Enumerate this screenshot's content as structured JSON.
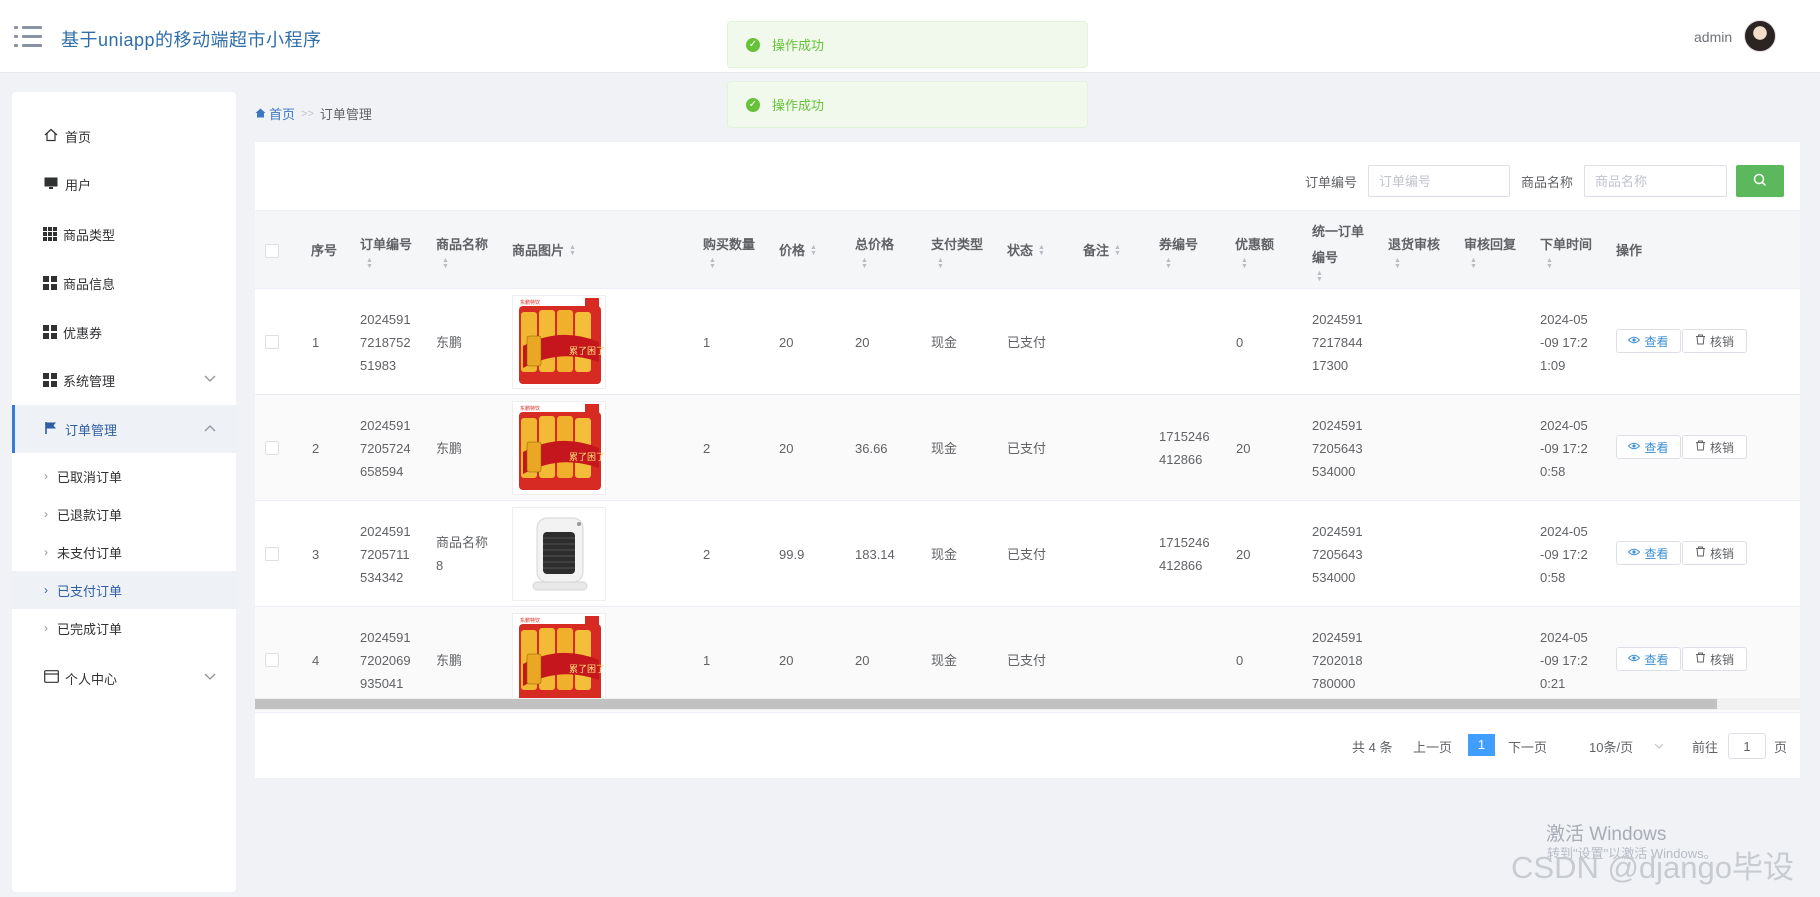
{
  "header": {
    "app_title": "基于uniapp的移动端超市小程序",
    "user_name": "admin"
  },
  "toasts": [
    {
      "message": "操作成功"
    },
    {
      "message": "操作成功"
    }
  ],
  "sidebar": {
    "items": [
      {
        "label": "首页",
        "icon": "home-icon"
      },
      {
        "label": "用户",
        "icon": "monitor-icon"
      },
      {
        "label": "商品类型",
        "icon": "grid-icon"
      },
      {
        "label": "商品信息",
        "icon": "grid-icon"
      },
      {
        "label": "优惠券",
        "icon": "grid-icon"
      },
      {
        "label": "系统管理",
        "icon": "grid-icon"
      },
      {
        "label": "订单管理",
        "icon": "flag-icon"
      },
      {
        "label": "个人中心",
        "icon": "card-icon"
      }
    ],
    "sub_items": [
      {
        "label": "已取消订单"
      },
      {
        "label": "已退款订单"
      },
      {
        "label": "未支付订单"
      },
      {
        "label": "已支付订单"
      },
      {
        "label": "已完成订单"
      }
    ]
  },
  "breadcrumb": {
    "home": "首页",
    "separator": ">>",
    "current": "订单管理"
  },
  "search": {
    "order_no_label": "订单编号",
    "order_no_placeholder": "订单编号",
    "product_name_label": "商品名称",
    "product_name_placeholder": "商品名称"
  },
  "table": {
    "columns": {
      "index": "序号",
      "order_no": "订单编号",
      "product_name": "商品名称",
      "product_image": "商品图片",
      "quantity": "购买数量",
      "price": "价格",
      "total": "总价格",
      "pay_type": "支付类型",
      "status": "状态",
      "remark": "备注",
      "coupon_no": "券编号",
      "discount": "优惠额",
      "unified_no": "统一订单\n编号",
      "refund_review": "退货审核",
      "review_reply": "审核回复",
      "order_time": "下单时间",
      "actions": "操作"
    },
    "rows": [
      {
        "index": "1",
        "order_no": "2024591\n7218752\n51983",
        "product_name": "东鹏",
        "image": "drink",
        "quantity": "1",
        "price": "20",
        "total": "20",
        "pay_type": "现金",
        "status": "已支付",
        "remark": "",
        "coupon_no": "",
        "discount": "0",
        "unified_no": "2024591\n7217844\n17300",
        "refund_review": "",
        "review_reply": "",
        "order_time": "2024-05\n-09 17:2\n1:09"
      },
      {
        "index": "2",
        "order_no": "2024591\n7205724\n658594",
        "product_name": "东鹏",
        "image": "drink",
        "quantity": "2",
        "price": "20",
        "total": "36.66",
        "pay_type": "现金",
        "status": "已支付",
        "remark": "",
        "coupon_no": "1715246\n412866",
        "discount": "20",
        "unified_no": "2024591\n7205643\n534000",
        "refund_review": "",
        "review_reply": "",
        "order_time": "2024-05\n-09 17:2\n0:58"
      },
      {
        "index": "3",
        "order_no": "2024591\n7205711\n534342",
        "product_name": "商品名称\n8",
        "image": "heater",
        "quantity": "2",
        "price": "99.9",
        "total": "183.14",
        "pay_type": "现金",
        "status": "已支付",
        "remark": "",
        "coupon_no": "1715246\n412866",
        "discount": "20",
        "unified_no": "2024591\n7205643\n534000",
        "refund_review": "",
        "review_reply": "",
        "order_time": "2024-05\n-09 17:2\n0:58"
      },
      {
        "index": "4",
        "order_no": "2024591\n7202069\n935041",
        "product_name": "东鹏",
        "image": "drink",
        "quantity": "1",
        "price": "20",
        "total": "20",
        "pay_type": "现金",
        "status": "已支付",
        "remark": "",
        "coupon_no": "",
        "discount": "0",
        "unified_no": "2024591\n7202018\n780000",
        "refund_review": "",
        "review_reply": "",
        "order_time": "2024-05\n-09 17:2\n0:21"
      }
    ],
    "view_label": "查看",
    "writeoff_label": "核销"
  },
  "pagination": {
    "total": "共 4 条",
    "prev": "上一页",
    "current_page": "1",
    "next": "下一页",
    "page_size": "10条/页",
    "goto": "前往",
    "goto_value": "1",
    "page_unit": "页"
  },
  "watermark": {
    "activate": "激活 Windows",
    "activate_hint": "转到\"设置\"以激活 Windows。",
    "csdn": "CSDN @django毕设"
  },
  "colors": {
    "accent": "#409eff",
    "success": "#67c23a",
    "search_button": "#5cb85c",
    "title": "#2f6ea8"
  }
}
